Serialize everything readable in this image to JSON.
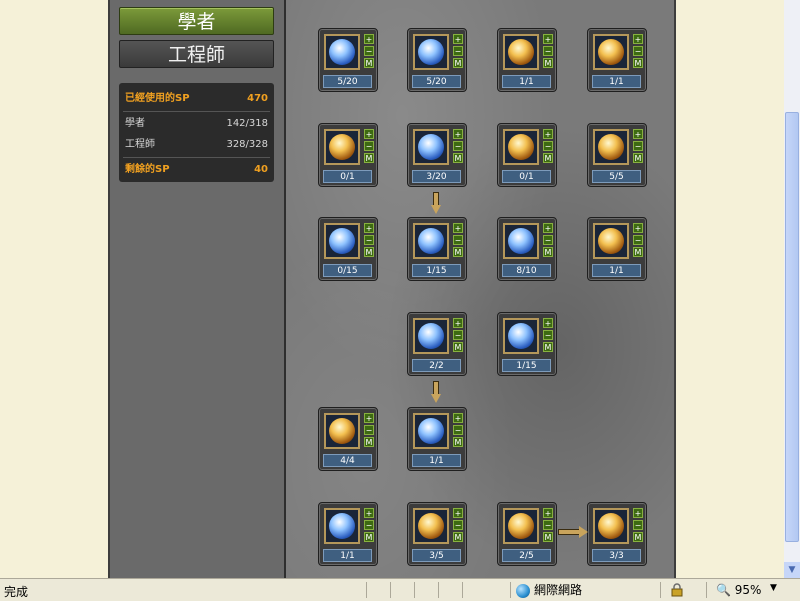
{
  "classes": [
    "學者",
    "工程師"
  ],
  "sp": {
    "used_label": "已經使用的SP",
    "used_value": "470",
    "rows": [
      {
        "label": "學者",
        "value": "142/318"
      },
      {
        "label": "工程師",
        "value": "328/328"
      }
    ],
    "remaining_label": "剩餘的SP",
    "remaining_value": "40"
  },
  "skill_button_labels": {
    "plus": "+",
    "minus": "−",
    "max": "M"
  },
  "skills": [
    {
      "level": "5/20",
      "tone": "blue"
    },
    {
      "level": "5/20",
      "tone": "blue"
    },
    {
      "level": "1/1",
      "tone": "warm"
    },
    {
      "level": "1/1",
      "tone": "warm"
    },
    {
      "level": "0/1",
      "tone": "warm"
    },
    {
      "level": "3/20",
      "tone": "blue"
    },
    {
      "level": "0/1",
      "tone": "warm"
    },
    {
      "level": "5/5",
      "tone": "warm"
    },
    {
      "level": "0/15",
      "tone": "blue"
    },
    {
      "level": "1/15",
      "tone": "blue"
    },
    {
      "level": "8/10",
      "tone": "blue"
    },
    {
      "level": "1/1",
      "tone": "warm"
    },
    {
      "level": "2/2",
      "tone": "blue"
    },
    {
      "level": "1/15",
      "tone": "blue"
    },
    {
      "level": "4/4",
      "tone": "warm"
    },
    {
      "level": "1/1",
      "tone": "blue"
    },
    {
      "level": "1/1",
      "tone": "blue"
    },
    {
      "level": "3/5",
      "tone": "warm"
    },
    {
      "level": "2/5",
      "tone": "warm"
    },
    {
      "level": "3/3",
      "tone": "warm"
    }
  ],
  "statusbar": {
    "status": "完成",
    "zone": "網際網路",
    "zoom": "95%",
    "zoom_arrow": "▼"
  }
}
